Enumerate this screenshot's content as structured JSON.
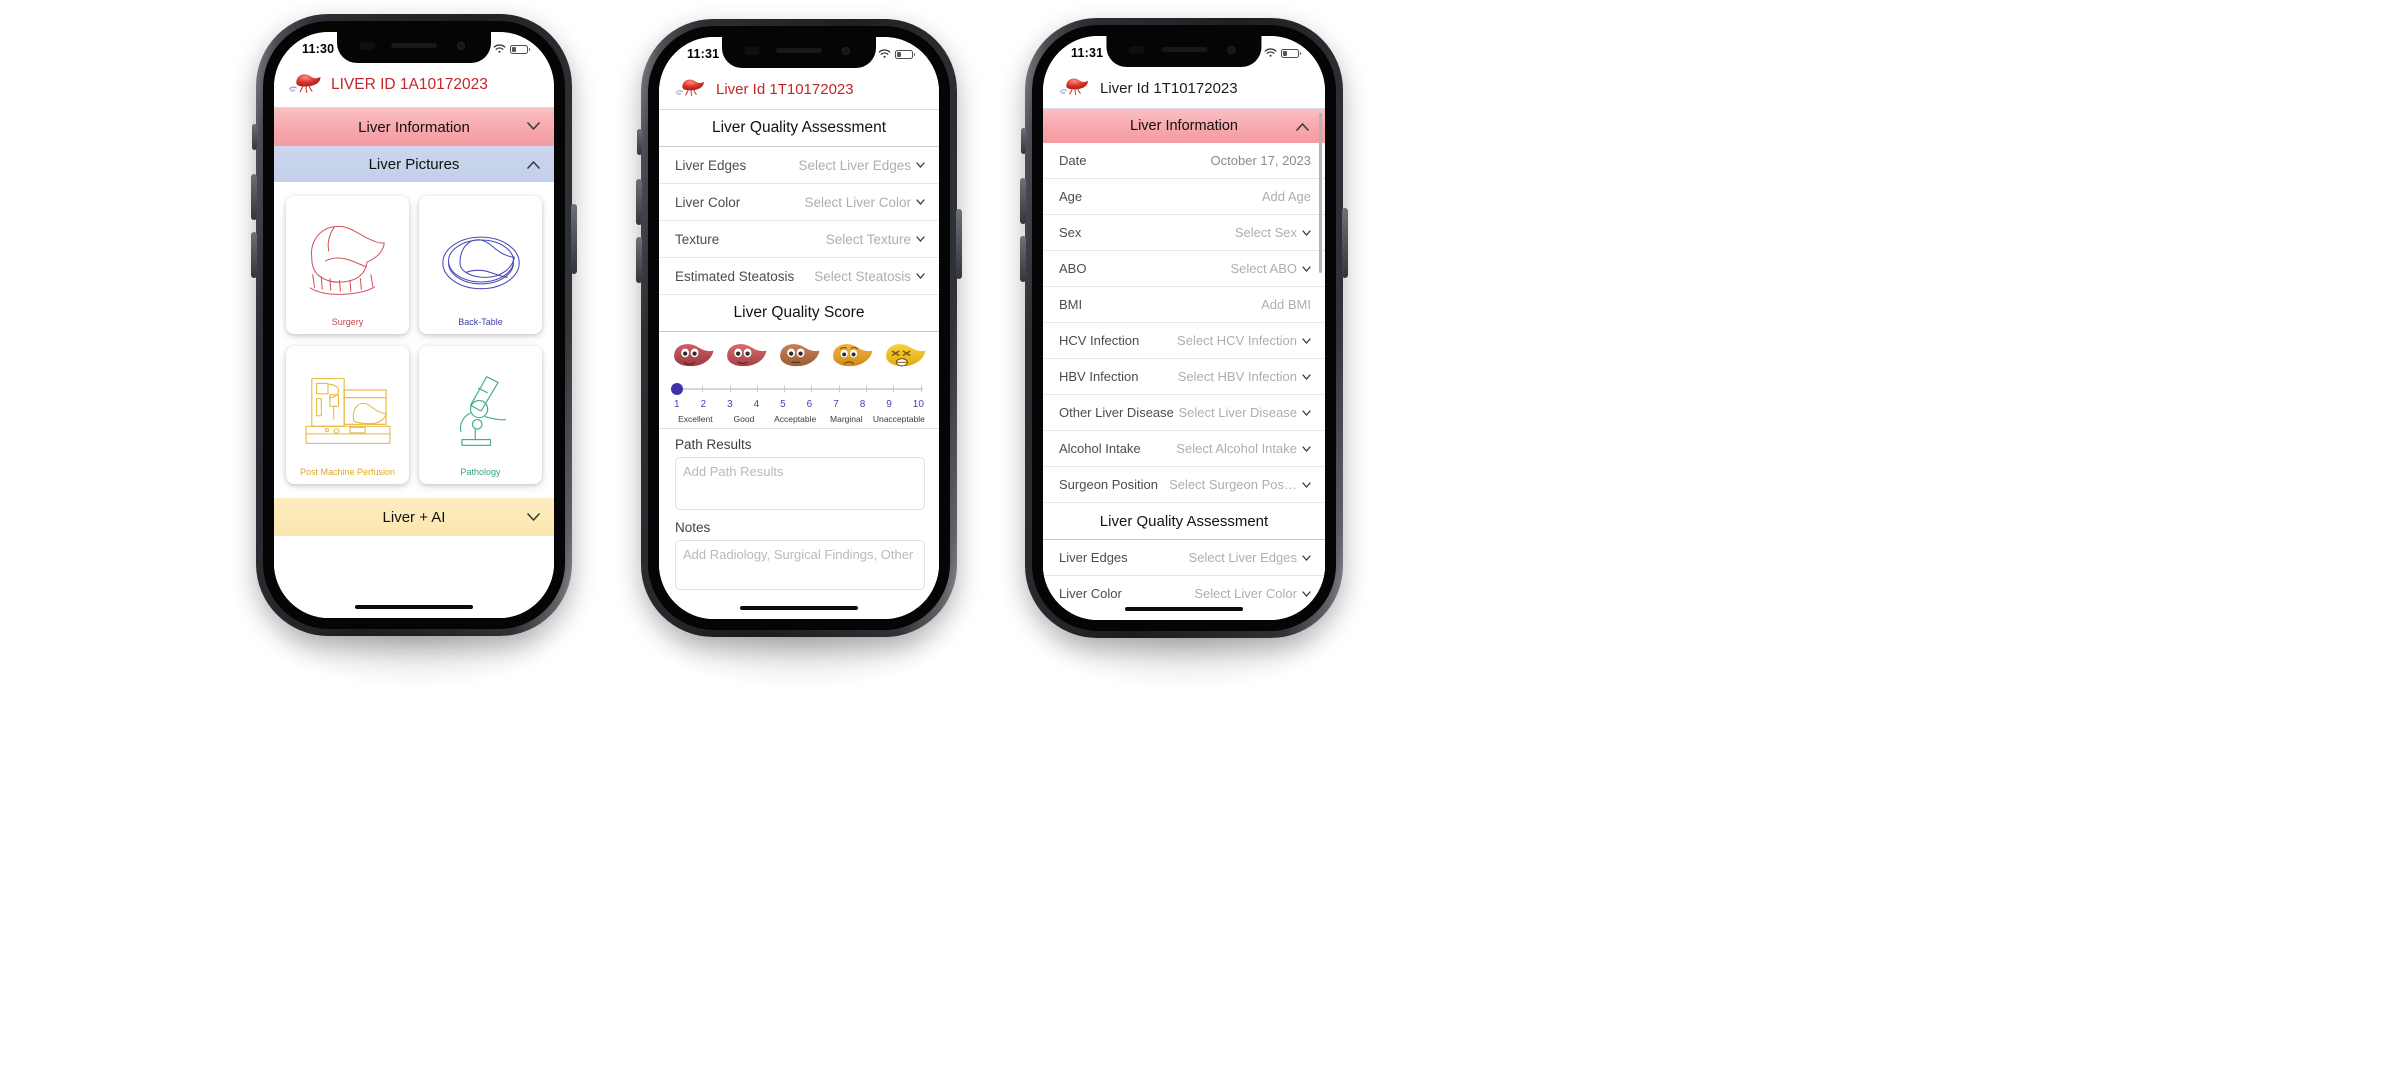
{
  "phones": [
    {
      "id": "phone-liver-pictures",
      "status_bar": {
        "time": "11:30",
        "wifi_icon": "wifi-icon",
        "battery_icon": "battery-icon"
      },
      "header": {
        "logo_icon": "liver-logo-icon",
        "title": "LIVER ID 1A10172023"
      },
      "accordions": [
        {
          "label": "Liver Information",
          "state": "collapsed",
          "chevron": "chevron-down-icon",
          "color": "#f7a8ad"
        },
        {
          "label": "Liver Pictures",
          "state": "expanded",
          "chevron": "chevron-up-icon",
          "color": "#c6d2ea"
        },
        {
          "label": "Liver + AI",
          "state": "collapsed",
          "chevron": "chevron-down-icon",
          "color": "#fbe6ac"
        }
      ],
      "picture_tiles": [
        {
          "label": "Surgery",
          "icon": "liver-surgery-icon",
          "color": "#d4535e"
        },
        {
          "label": "Back-Table",
          "icon": "liver-back-table-icon",
          "color": "#4a49b8"
        },
        {
          "label": "Post Machine Perfusion",
          "icon": "perfusion-machine-icon",
          "color": "#e8b63a"
        },
        {
          "label": "Pathology",
          "icon": "microscope-icon",
          "color": "#3fae8d"
        }
      ]
    },
    {
      "id": "phone-quality-assessment",
      "status_bar": {
        "time": "11:31",
        "wifi_icon": "wifi-icon",
        "battery_icon": "battery-icon"
      },
      "header": {
        "logo_icon": "liver-logo-icon",
        "title": "Liver Id 1T10172023"
      },
      "section_title": "Liver Quality Assessment",
      "fields": [
        {
          "label": "Liver Edges",
          "value": "Select Liver Edges",
          "control": "select"
        },
        {
          "label": "Liver Color",
          "value": "Select Liver Color",
          "control": "select"
        },
        {
          "label": "Texture",
          "value": "Select Texture",
          "control": "select"
        },
        {
          "label": "Estimated Steatosis",
          "value": "Select Steatosis",
          "control": "select"
        }
      ],
      "quality_score": {
        "title": "Liver Quality Score",
        "faces": [
          {
            "name": "liver-face-excellent",
            "color": "#b8464f",
            "mouth": "smile"
          },
          {
            "name": "liver-face-good",
            "color": "#c0515a",
            "mouth": "smile"
          },
          {
            "name": "liver-face-acceptable",
            "color": "#b5704a",
            "mouth": "flat"
          },
          {
            "name": "liver-face-marginal",
            "color": "#e3a130",
            "mouth": "frown"
          },
          {
            "name": "liver-face-unacceptable",
            "color": "#ecc026",
            "mouth": "distress"
          }
        ],
        "scale": [
          "1",
          "2",
          "3",
          "4",
          "5",
          "6",
          "7",
          "8",
          "9",
          "10"
        ],
        "words": [
          "Excellent",
          "Good",
          "Acceptable",
          "Marginal",
          "Unacceptable"
        ],
        "selected_value": 1,
        "knob_color": "#3f32a8"
      },
      "path_results": {
        "label": "Path Results",
        "placeholder": "Add Path Results"
      },
      "notes": {
        "label": "Notes",
        "placeholder": "Add Radiology, Surgical Findings, Other"
      }
    },
    {
      "id": "phone-liver-information",
      "status_bar": {
        "time": "11:31",
        "wifi_icon": "wifi-icon",
        "battery_icon": "battery-icon"
      },
      "header": {
        "logo_icon": "liver-logo-icon",
        "title": "Liver Id 1T10172023"
      },
      "accordion": {
        "label": "Liver Information",
        "state": "expanded",
        "chevron": "chevron-up-icon",
        "color": "#f7a8ad"
      },
      "fields": [
        {
          "label": "Date",
          "value": "October 17, 2023",
          "control": "text",
          "filled": true
        },
        {
          "label": "Age",
          "value": "Add Age",
          "control": "text"
        },
        {
          "label": "Sex",
          "value": "Select Sex",
          "control": "select"
        },
        {
          "label": "ABO",
          "value": "Select ABO",
          "control": "select"
        },
        {
          "label": "BMI",
          "value": "Add BMI",
          "control": "text"
        },
        {
          "label": "HCV Infection",
          "value": "Select HCV Infection",
          "control": "select"
        },
        {
          "label": "HBV Infection",
          "value": "Select HBV Infection",
          "control": "select"
        },
        {
          "label": "Other Liver Disease",
          "value": "Select Liver Disease",
          "control": "select"
        },
        {
          "label": "Alcohol Intake",
          "value": "Select Alcohol Intake",
          "control": "select"
        },
        {
          "label": "Surgeon Position",
          "value": "Select Surgeon Pos…",
          "control": "select"
        }
      ],
      "section_title": "Liver Quality Assessment",
      "fields2": [
        {
          "label": "Liver Edges",
          "value": "Select Liver Edges",
          "control": "select"
        },
        {
          "label": "Liver Color",
          "value": "Select Liver Color",
          "control": "select"
        }
      ]
    }
  ]
}
